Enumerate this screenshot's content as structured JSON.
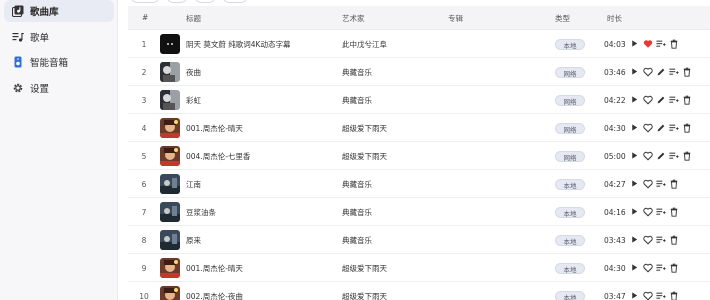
{
  "sidebar": {
    "items": [
      {
        "label": "歌曲库",
        "icon": "music-library-icon",
        "active": true
      },
      {
        "label": "歌单",
        "icon": "playlist-icon",
        "active": false
      },
      {
        "label": "智能音箱",
        "icon": "smart-speaker-icon",
        "active": false
      },
      {
        "label": "设置",
        "icon": "gear-icon",
        "active": false
      }
    ]
  },
  "table": {
    "headers": {
      "index": "#",
      "title": "标题",
      "artist": "艺术家",
      "album": "专辑",
      "type": "类型",
      "duration": "时长"
    },
    "rows": [
      {
        "index": "1",
        "title": "阴天 莫文蔚 纯歌词4K动态字幕",
        "artist": "此中戊兮江阜",
        "type": "本地",
        "duration": "04:03",
        "liked": true,
        "editable": false,
        "thumb": "dark"
      },
      {
        "index": "2",
        "title": "夜曲",
        "artist": "典藏音乐",
        "type": "网络",
        "duration": "03:46",
        "liked": false,
        "editable": true,
        "thumb": "jay-bw"
      },
      {
        "index": "3",
        "title": "彩虹",
        "artist": "典藏音乐",
        "type": "网络",
        "duration": "04:22",
        "liked": false,
        "editable": true,
        "thumb": "jay-bw"
      },
      {
        "index": "4",
        "title": "001.周杰伦-晴天",
        "artist": "超级爱下雨天",
        "type": "网络",
        "duration": "04:30",
        "liked": false,
        "editable": true,
        "thumb": "anime"
      },
      {
        "index": "5",
        "title": "004.周杰伦-七里香",
        "artist": "超级爱下雨天",
        "type": "网络",
        "duration": "05:00",
        "liked": false,
        "editable": true,
        "thumb": "anime"
      },
      {
        "index": "6",
        "title": "江南",
        "artist": "典藏音乐",
        "type": "本地",
        "duration": "04:27",
        "liked": false,
        "editable": false,
        "thumb": "photo"
      },
      {
        "index": "7",
        "title": "豆浆油条",
        "artist": "典藏音乐",
        "type": "本地",
        "duration": "04:16",
        "liked": false,
        "editable": false,
        "thumb": "photo"
      },
      {
        "index": "8",
        "title": "原来",
        "artist": "典藏音乐",
        "type": "本地",
        "duration": "03:43",
        "liked": false,
        "editable": false,
        "thumb": "photo"
      },
      {
        "index": "9",
        "title": "001.周杰伦-晴天",
        "artist": "超级爱下雨天",
        "type": "本地",
        "duration": "04:30",
        "liked": false,
        "editable": false,
        "thumb": "anime"
      },
      {
        "index": "10",
        "title": "002.周杰伦-夜曲",
        "artist": "超级爱下雨天",
        "type": "本地",
        "duration": "03:47",
        "liked": false,
        "editable": false,
        "thumb": "anime"
      }
    ]
  },
  "colors": {
    "like_active": "#e53935",
    "tag_bg": "#e7e9f2",
    "sidebar_active": "#e8ebf3"
  }
}
